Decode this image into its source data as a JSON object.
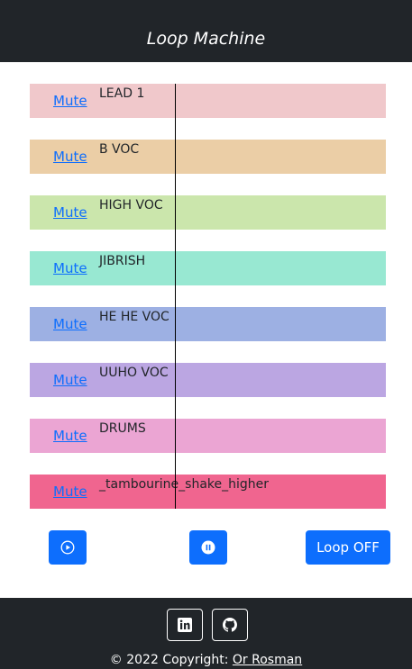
{
  "header": {
    "title": "Loop Machine"
  },
  "tracks": [
    {
      "mute_label": "Mute",
      "name": "LEAD 1",
      "color": "#f0c8cb"
    },
    {
      "mute_label": "Mute",
      "name": "B VOC",
      "color": "#ebcea6"
    },
    {
      "mute_label": "Mute",
      "name": "HIGH VOC",
      "color": "#cbe6ac"
    },
    {
      "mute_label": "Mute",
      "name": "JIBRISH",
      "color": "#98e8d2"
    },
    {
      "mute_label": "Mute",
      "name": "HE HE VOC",
      "color": "#9db0e3"
    },
    {
      "mute_label": "Mute",
      "name": "UUHO VOC",
      "color": "#bba6e2"
    },
    {
      "mute_label": "Mute",
      "name": "DRUMS",
      "color": "#eba5d3"
    },
    {
      "mute_label": "Mute",
      "name": "_tambourine_shake_higher",
      "color": "#f0658f"
    }
  ],
  "controls": {
    "play_icon": "play-circle-icon",
    "pause_icon": "pause-circle-icon",
    "loop_label": "Loop OFF",
    "button_color": "#0d6efd"
  },
  "footer": {
    "linkedin_icon": "linkedin-icon",
    "github_icon": "github-icon",
    "copyright_prefix": "© 2022 Copyright: ",
    "author": "Or Rosman"
  }
}
